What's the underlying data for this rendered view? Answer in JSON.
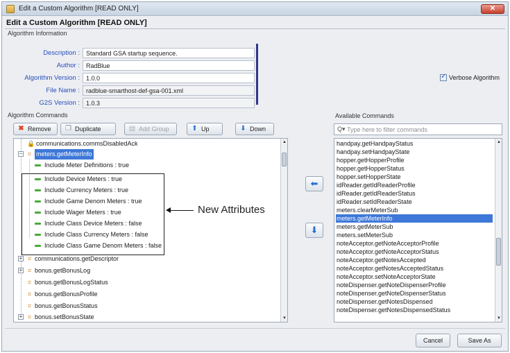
{
  "window": {
    "title": "Edit a Custom Algorithm [READ ONLY]",
    "heading": "Edit a Custom Algorithm [READ ONLY]",
    "close_glyph": "✕"
  },
  "algorithm_info": {
    "section_title": "Algorithm Information",
    "fields": [
      {
        "label": "Description :",
        "value": "Standard GSA startup sequence."
      },
      {
        "label": "Author :",
        "value": "RadBlue"
      },
      {
        "label": "Algorithm Version :",
        "value": "1.0.0"
      },
      {
        "label": "File Name :",
        "value": "radblue-smarthost-def-gsa-001.xml"
      },
      {
        "label": "G2S Version :",
        "value": "1.0.3"
      }
    ],
    "verbose_label": "Verbose Algorithm",
    "verbose_checked": true
  },
  "commands": {
    "section_title": "Algorithm Commands",
    "toolbar": {
      "remove": "Remove",
      "duplicate": "Duplicate",
      "add_group": "Add Group",
      "up": "Up",
      "down": "Down"
    },
    "tree": [
      {
        "label": "communications.commsDisabledAck",
        "kind": "locked",
        "level": 1
      },
      {
        "label": "meters.getMeterInfo",
        "kind": "command",
        "level": 0,
        "expanded": true,
        "selected": true
      },
      {
        "label": "Include Meter Definitions : true",
        "kind": "attr",
        "level": 2
      },
      {
        "label": "Include Device Meters : true",
        "kind": "attr",
        "level": 2
      },
      {
        "label": "Include Currency Meters : true",
        "kind": "attr",
        "level": 2
      },
      {
        "label": "Include Game Denom Meters : true",
        "kind": "attr",
        "level": 2
      },
      {
        "label": "Include Wager Meters : true",
        "kind": "attr",
        "level": 2
      },
      {
        "label": "Include Class Device Meters : false",
        "kind": "attr",
        "level": 2
      },
      {
        "label": "Include Class Currency Meters : false",
        "kind": "attr",
        "level": 2
      },
      {
        "label": "Include Class Game Denom Meters : false",
        "kind": "attr",
        "level": 2
      },
      {
        "label": "communications.getDescriptor",
        "kind": "command",
        "level": 0,
        "expanded": false
      },
      {
        "label": "bonus.getBonusLog",
        "kind": "command",
        "level": 0,
        "expanded": false
      },
      {
        "label": "bonus.getBonusLogStatus",
        "kind": "command",
        "level": 1
      },
      {
        "label": "bonus.getBonusProfile",
        "kind": "command",
        "level": 1
      },
      {
        "label": "bonus.getBonusStatus",
        "kind": "command",
        "level": 1
      },
      {
        "label": "bonus.setBonusState",
        "kind": "command",
        "level": 0,
        "expanded": false
      }
    ],
    "annotation": "New Attributes"
  },
  "available": {
    "section_title": "Available Commands",
    "filter_placeholder": "Type here to filter commands",
    "items": [
      "handpay.getHandpayStatus",
      "handpay.setHandpayState",
      "hopper.getHopperProfile",
      "hopper.getHopperStatus",
      "hopper.setHopperState",
      "idReader.getIdReaderProfile",
      "idReader.getIdReaderStatus",
      "idReader.setIdReaderState",
      "meters.clearMeterSub",
      "meters.getMeterInfo",
      "meters.getMeterSub",
      "meters.setMeterSub",
      "noteAcceptor.getNoteAcceptorProfile",
      "noteAcceptor.getNoteAcceptorStatus",
      "noteAcceptor.getNotesAccepted",
      "noteAcceptor.getNotesAcceptedStatus",
      "noteAcceptor.setNoteAcceptorState",
      "noteDispenser.getNoteDispenserProfile",
      "noteDispenser.getNoteDispenserStatus",
      "noteDispenser.getNotesDispensed",
      "noteDispenser.getNotesDispensedStatus"
    ],
    "selected_index": 9
  },
  "footer": {
    "cancel": "Cancel",
    "save_as": "Save As"
  },
  "colors": {
    "selection": "#3e78d8",
    "label_blue": "#2a4fb8",
    "divider_navy": "#31378a",
    "attribute_green": "#49a93a",
    "command_orange": "#d08a2c"
  }
}
